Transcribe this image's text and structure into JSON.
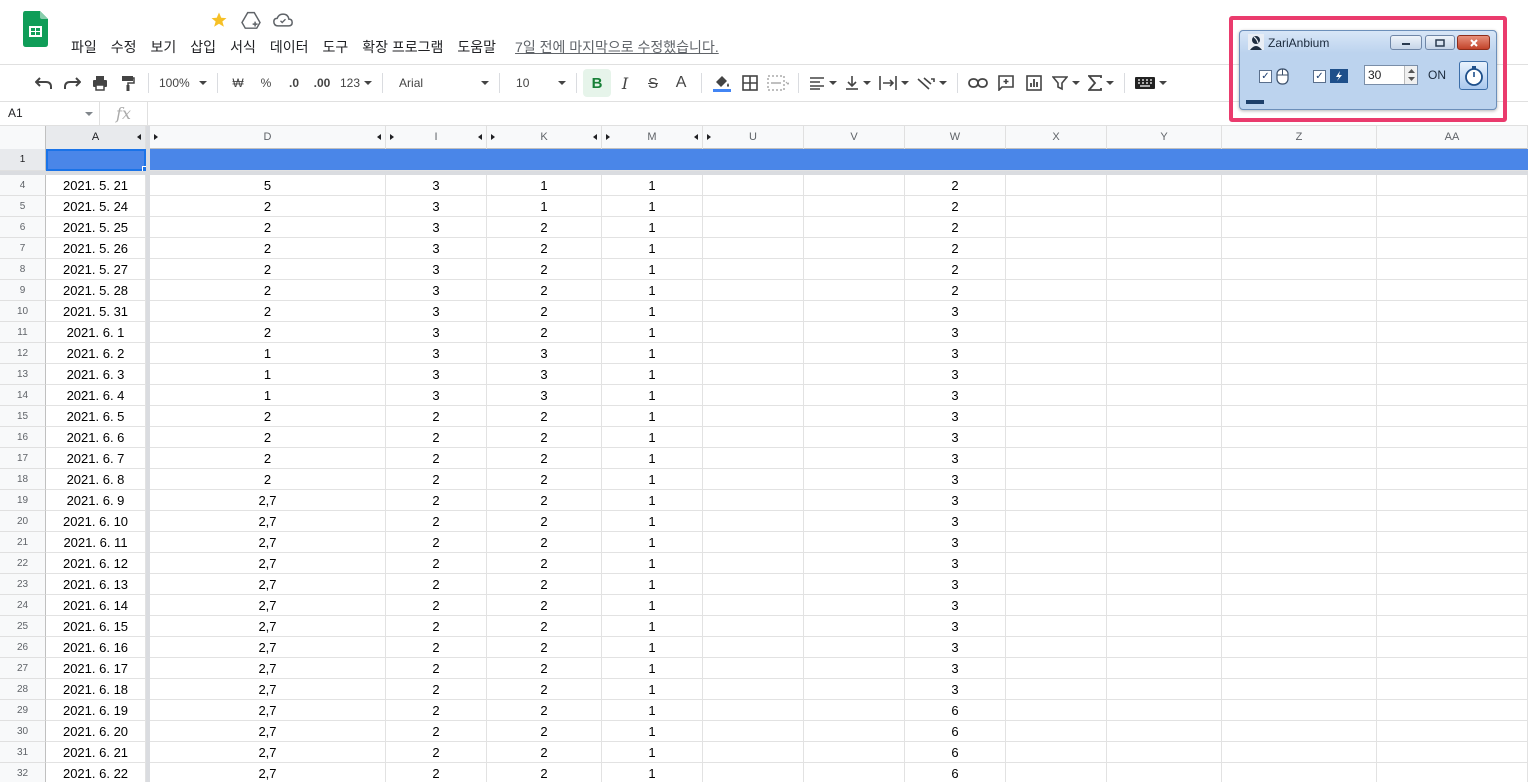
{
  "menu": {
    "items": [
      "파일",
      "수정",
      "보기",
      "삽입",
      "서식",
      "데이터",
      "도구",
      "확장 프로그램",
      "도움말"
    ],
    "last_edit": "7일 전에 마지막으로 수정했습니다."
  },
  "toolbar": {
    "zoom": "100%",
    "currency": "₩",
    "percent": "%",
    "dec_decrease": ".0",
    "dec_increase": ".00",
    "format_more": "123",
    "font": "Arial",
    "font_size": "10",
    "bold": "B",
    "italic": "I",
    "strike": "S",
    "text_color": "A"
  },
  "formula_bar": {
    "cell_ref": "A1",
    "fx": "fx"
  },
  "columns": [
    "A",
    "D",
    "I",
    "K",
    "M",
    "U",
    "V",
    "W",
    "X",
    "Y",
    "Z",
    "AA"
  ],
  "row1_label": "1",
  "rows": [
    {
      "n": "4",
      "A": "2021. 5. 21",
      "D": "5",
      "I": "3",
      "K": "1",
      "M": "1",
      "W": "2"
    },
    {
      "n": "5",
      "A": "2021. 5. 24",
      "D": "2",
      "I": "3",
      "K": "1",
      "M": "1",
      "W": "2"
    },
    {
      "n": "6",
      "A": "2021. 5. 25",
      "D": "2",
      "I": "3",
      "K": "2",
      "M": "1",
      "W": "2"
    },
    {
      "n": "7",
      "A": "2021. 5. 26",
      "D": "2",
      "I": "3",
      "K": "2",
      "M": "1",
      "W": "2"
    },
    {
      "n": "8",
      "A": "2021. 5. 27",
      "D": "2",
      "I": "3",
      "K": "2",
      "M": "1",
      "W": "2"
    },
    {
      "n": "9",
      "A": "2021. 5. 28",
      "D": "2",
      "I": "3",
      "K": "2",
      "M": "1",
      "W": "2"
    },
    {
      "n": "10",
      "A": "2021. 5. 31",
      "D": "2",
      "I": "3",
      "K": "2",
      "M": "1",
      "W": "3"
    },
    {
      "n": "11",
      "A": "2021. 6. 1",
      "D": "2",
      "I": "3",
      "K": "2",
      "M": "1",
      "W": "3"
    },
    {
      "n": "12",
      "A": "2021. 6. 2",
      "D": "1",
      "I": "3",
      "K": "3",
      "M": "1",
      "W": "3"
    },
    {
      "n": "13",
      "A": "2021. 6. 3",
      "D": "1",
      "I": "3",
      "K": "3",
      "M": "1",
      "W": "3"
    },
    {
      "n": "14",
      "A": "2021. 6. 4",
      "D": "1",
      "I": "3",
      "K": "3",
      "M": "1",
      "W": "3"
    },
    {
      "n": "15",
      "A": "2021. 6. 5",
      "D": "2",
      "I": "2",
      "K": "2",
      "M": "1",
      "W": "3"
    },
    {
      "n": "16",
      "A": "2021. 6. 6",
      "D": "2",
      "I": "2",
      "K": "2",
      "M": "1",
      "W": "3"
    },
    {
      "n": "17",
      "A": "2021. 6. 7",
      "D": "2",
      "I": "2",
      "K": "2",
      "M": "1",
      "W": "3"
    },
    {
      "n": "18",
      "A": "2021. 6. 8",
      "D": "2",
      "I": "2",
      "K": "2",
      "M": "1",
      "W": "3"
    },
    {
      "n": "19",
      "A": "2021. 6. 9",
      "D": "2,7",
      "I": "2",
      "K": "2",
      "M": "1",
      "W": "3"
    },
    {
      "n": "20",
      "A": "2021. 6. 10",
      "D": "2,7",
      "I": "2",
      "K": "2",
      "M": "1",
      "W": "3"
    },
    {
      "n": "21",
      "A": "2021. 6. 11",
      "D": "2,7",
      "I": "2",
      "K": "2",
      "M": "1",
      "W": "3"
    },
    {
      "n": "22",
      "A": "2021. 6. 12",
      "D": "2,7",
      "I": "2",
      "K": "2",
      "M": "1",
      "W": "3"
    },
    {
      "n": "23",
      "A": "2021. 6. 13",
      "D": "2,7",
      "I": "2",
      "K": "2",
      "M": "1",
      "W": "3"
    },
    {
      "n": "24",
      "A": "2021. 6. 14",
      "D": "2,7",
      "I": "2",
      "K": "2",
      "M": "1",
      "W": "3"
    },
    {
      "n": "25",
      "A": "2021. 6. 15",
      "D": "2,7",
      "I": "2",
      "K": "2",
      "M": "1",
      "W": "3"
    },
    {
      "n": "26",
      "A": "2021. 6. 16",
      "D": "2,7",
      "I": "2",
      "K": "2",
      "M": "1",
      "W": "3"
    },
    {
      "n": "27",
      "A": "2021. 6. 17",
      "D": "2,7",
      "I": "2",
      "K": "2",
      "M": "1",
      "W": "3"
    },
    {
      "n": "28",
      "A": "2021. 6. 18",
      "D": "2,7",
      "I": "2",
      "K": "2",
      "M": "1",
      "W": "3"
    },
    {
      "n": "29",
      "A": "2021. 6. 19",
      "D": "2,7",
      "I": "2",
      "K": "2",
      "M": "1",
      "W": "6"
    },
    {
      "n": "30",
      "A": "2021. 6. 20",
      "D": "2,7",
      "I": "2",
      "K": "2",
      "M": "1",
      "W": "6"
    },
    {
      "n": "31",
      "A": "2021. 6. 21",
      "D": "2,7",
      "I": "2",
      "K": "2",
      "M": "1",
      "W": "6"
    },
    {
      "n": "32",
      "A": "2021. 6. 22",
      "D": "2,7",
      "I": "2",
      "K": "2",
      "M": "1",
      "W": "6"
    }
  ],
  "widget": {
    "title": "ZariAnbium",
    "interval": "30",
    "status": "ON"
  },
  "colors": {
    "header_fill": "#4a86e8",
    "highlight": "#ea3b6d",
    "sheets_green": "#0f9d58"
  }
}
